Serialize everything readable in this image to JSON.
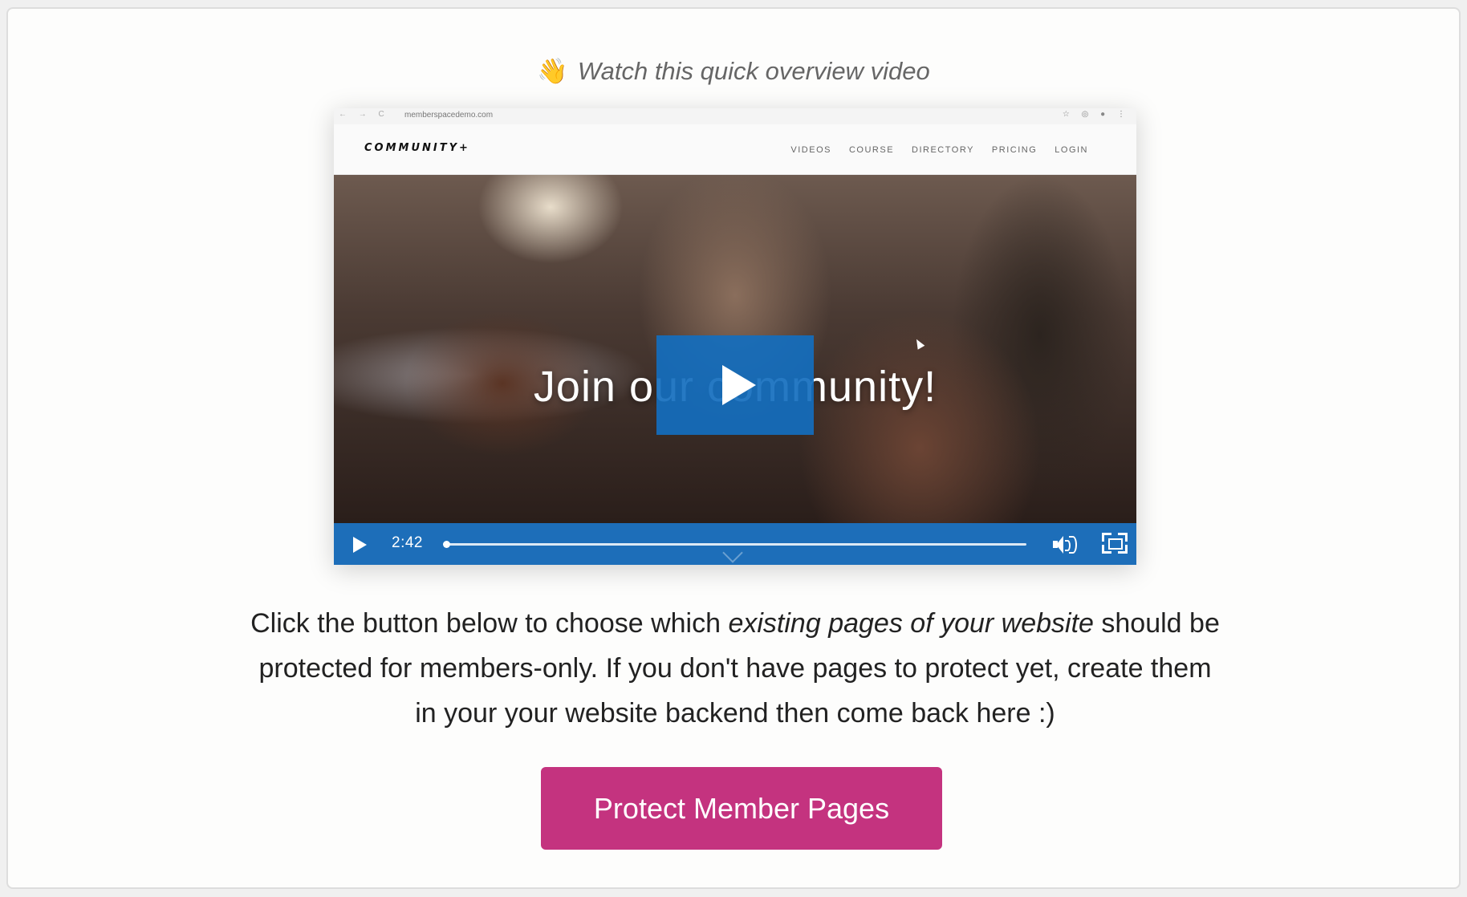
{
  "heading": {
    "emoji": "👋",
    "text": "Watch this quick overview video"
  },
  "video": {
    "browser": {
      "nav_icons": "← → C",
      "url": "memberspacedemo.com",
      "extension_icons": "☆ ◎ ● ⋮"
    },
    "site": {
      "logo": "COMMUNITY+",
      "nav": [
        "VIDEOS",
        "COURSE",
        "DIRECTORY",
        "PRICING",
        "LOGIN"
      ]
    },
    "overlay_title": "Join our community!",
    "controls": {
      "time": "2:42",
      "progress": 0.0
    },
    "accent_color": "#1e73c3"
  },
  "description": {
    "before": "Click the button below to choose which ",
    "emphasis": "existing pages of your website",
    "after": " should be protected for members-only. If you don't have pages to protect yet, create them in your your website backend then come back here :)"
  },
  "cta": {
    "label": "Protect Member Pages",
    "color": "#c4337f"
  }
}
